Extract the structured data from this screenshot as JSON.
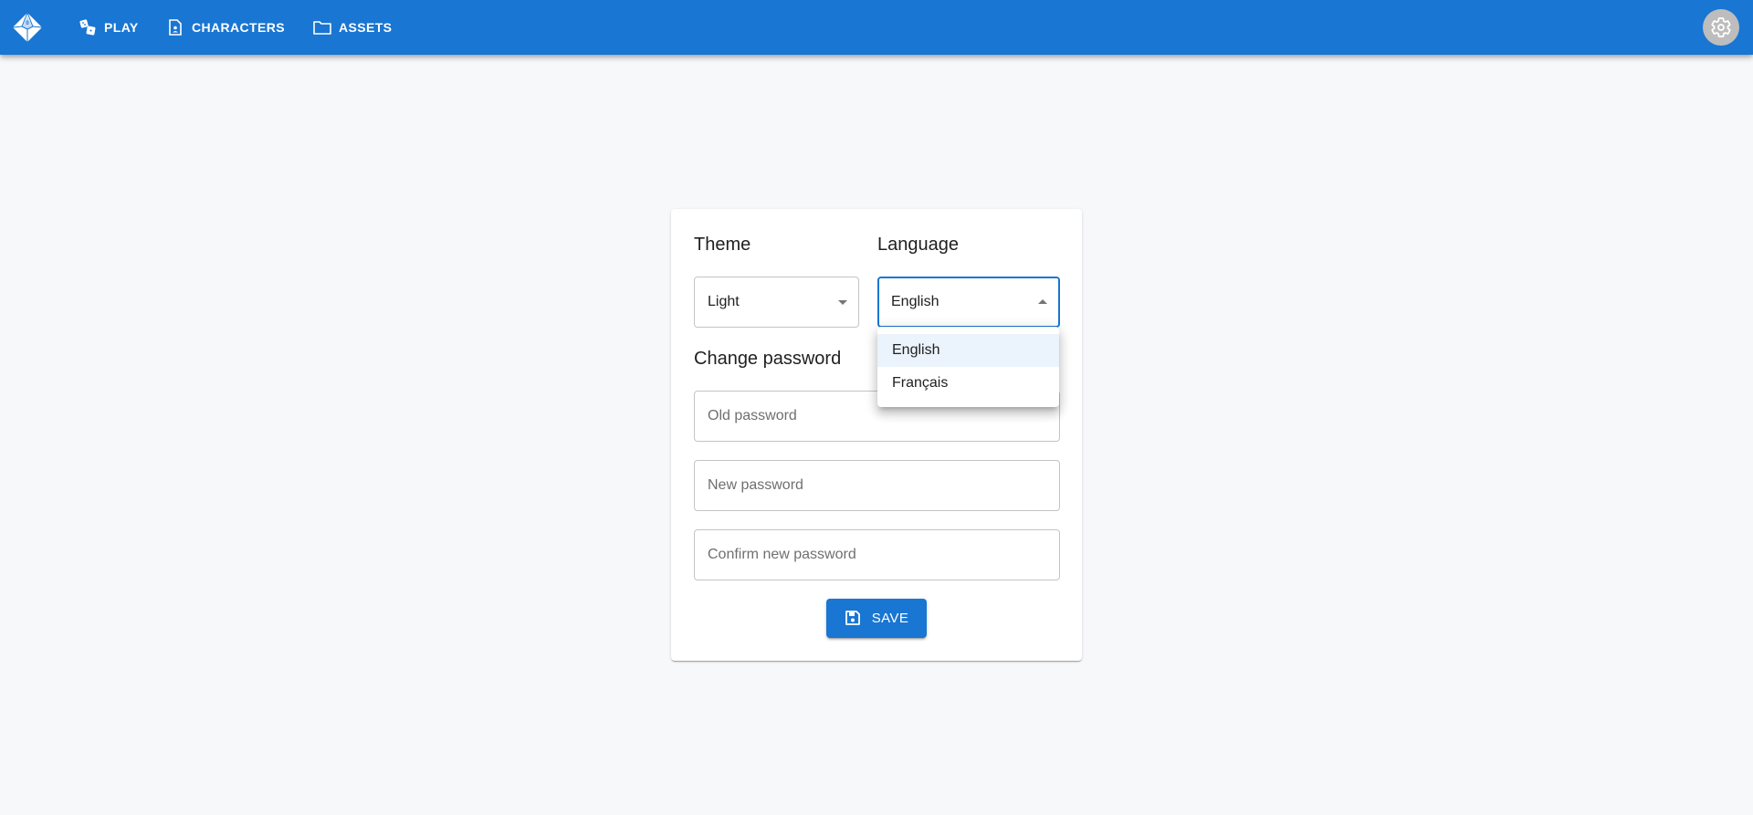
{
  "appbar": {
    "logo": "d10-dice-logo",
    "nav": [
      {
        "label": "PLAY",
        "icon": "dice-icon"
      },
      {
        "label": "CHARACTERS",
        "icon": "character-sheet-icon"
      },
      {
        "label": "ASSETS",
        "icon": "folder-icon"
      }
    ],
    "settings_icon": "gear-icon"
  },
  "settings": {
    "theme": {
      "title": "Theme",
      "value": "Light"
    },
    "language": {
      "title": "Language",
      "value": "English",
      "open": true,
      "options": [
        "English",
        "Français"
      ],
      "selected_index": 0
    },
    "password": {
      "title": "Change password",
      "old_placeholder": "Old password",
      "new_placeholder": "New password",
      "confirm_placeholder": "Confirm new password"
    },
    "save_label": "SAVE"
  },
  "colors": {
    "primary": "#1976d2",
    "background": "#f7f8fa",
    "selected_option": "#ebf3fc"
  }
}
